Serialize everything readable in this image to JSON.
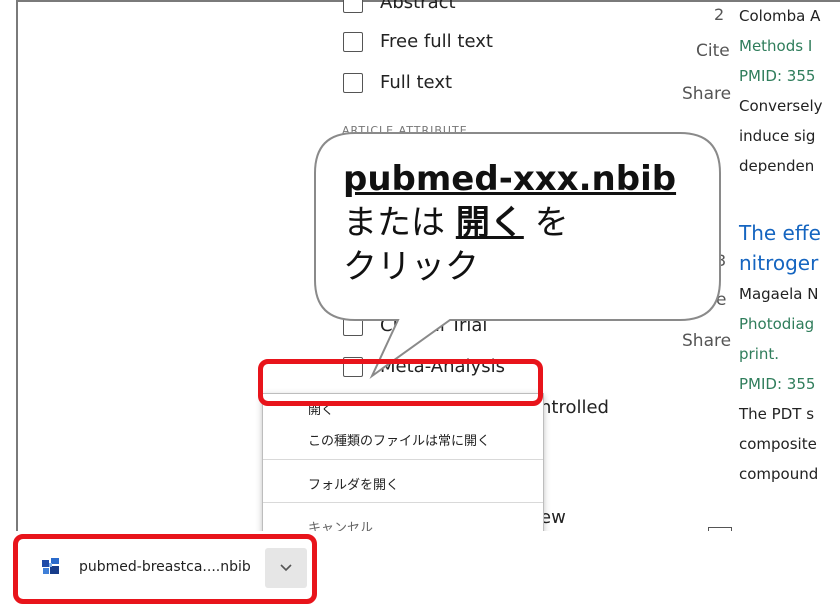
{
  "filters": {
    "top_partial": "Abstract",
    "free_full_text": "Free full text",
    "full_text": "Full text",
    "section_label": "ARTICLE ATTRIBUTE",
    "clinical_trial_partial": "Clinical Trial",
    "meta_analysis": "Meta-Analysis",
    "rct_partial": "ntrolled",
    "review_partial": "ew"
  },
  "actions": {
    "num": "2",
    "cite": "Cite",
    "share1": "Share",
    "num2": "3",
    "cite2_partial": "e",
    "share2": "Share"
  },
  "results": {
    "r1_author": "Colomba A",
    "r1_journal": "Methods I",
    "r1_pmid": "PMID: 355",
    "r1_snip1": "Conversely",
    "r1_snip2": "induce sig",
    "r1_snip3": "dependen",
    "r2_title1": "The effe",
    "r2_title2": "nitroger",
    "r2_author": "Magaela N",
    "r2_journal": "Photodiag",
    "r2_print": "print.",
    "r2_pmid": "PMID: 355",
    "r2_snip1": "The PDT s",
    "r2_snip2": "composite",
    "r2_snip3": "compound"
  },
  "callout": {
    "filename": "pubmed-xxx.nbib",
    "line2_pre": "または ",
    "line2_bold": "開く",
    "line2_post": " を",
    "line3": "クリック"
  },
  "context_menu": {
    "open": "開く",
    "always_open": "この種類のファイルは常に開く",
    "show_in_folder": "フォルダを開く",
    "cancel": "キャンセル"
  },
  "download_shelf": {
    "filename": "pubmed-breastca....nbib",
    "icon": "nbib-file-icon",
    "arrow": "chevron-down-icon"
  },
  "colors": {
    "highlight": "#e8141b",
    "link": "#1565c0",
    "journal": "#2f7d5b"
  }
}
